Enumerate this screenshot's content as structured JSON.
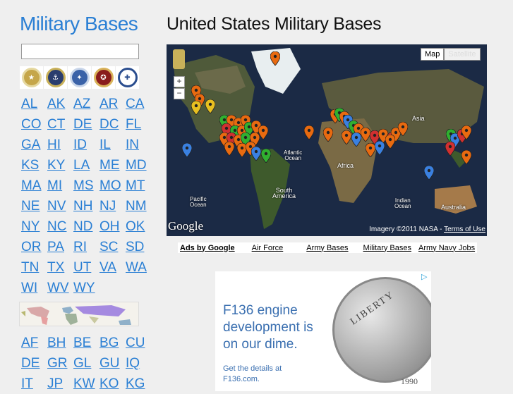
{
  "header": {
    "site_title": "Military Bases",
    "page_title": "United States Military Bases"
  },
  "search": {
    "value": "",
    "placeholder": ""
  },
  "branch_seals": [
    {
      "name": "army-seal-icon",
      "color": "#c5a64a"
    },
    {
      "name": "navy-seal-icon",
      "color": "#2a3d6e"
    },
    {
      "name": "air-force-seal-icon",
      "color": "#3a62a8"
    },
    {
      "name": "marine-corps-seal-icon",
      "color": "#8a1c1c"
    },
    {
      "name": "coast-guard-seal-icon",
      "color": "#2a4d8e"
    }
  ],
  "states": [
    "AL",
    "AK",
    "AZ",
    "AR",
    "CA",
    "CO",
    "CT",
    "DE",
    "DC",
    "FL",
    "GA",
    "HI",
    "ID",
    "IL",
    "IN",
    "KS",
    "KY",
    "LA",
    "ME",
    "MD",
    "MA",
    "MI",
    "MS",
    "MO",
    "MT",
    "NE",
    "NV",
    "NH",
    "NJ",
    "NM",
    "NY",
    "NC",
    "ND",
    "OH",
    "OK",
    "OR",
    "PA",
    "RI",
    "SC",
    "SD",
    "TN",
    "TX",
    "UT",
    "VA",
    "WA",
    "WI",
    "WV",
    "WY"
  ],
  "countries": [
    "AF",
    "BH",
    "BE",
    "BG",
    "CU",
    "DE",
    "GR",
    "GL",
    "GU",
    "IQ",
    "IT",
    "JP",
    "KW",
    "KO",
    "KG"
  ],
  "map": {
    "type_buttons": [
      "Map",
      "Satellite"
    ],
    "zoom_in": "+",
    "zoom_out": "−",
    "labels": {
      "asia": "Asia",
      "atlantic": "Atlantic\nOcean",
      "africa": "Africa",
      "south_america": "South\nAmerica",
      "pacific": "Pacific\nOcean",
      "indian": "Indian\nOcean",
      "australia": "Australia"
    },
    "logo": "Google",
    "imagery": "Imagery ©2011 NASA - ",
    "terms": "Terms of Use"
  },
  "ads_bar": {
    "label": "Ads by Google",
    "links": [
      "Air Force",
      "Army Bases",
      "Military Bases",
      "Army Navy Jobs"
    ]
  },
  "banner": {
    "headline": "F136 engine development is on our dime.",
    "sub": "Get the details at\nF136.com.",
    "coin_text": "LIBERTY",
    "coin_year": "1990"
  }
}
